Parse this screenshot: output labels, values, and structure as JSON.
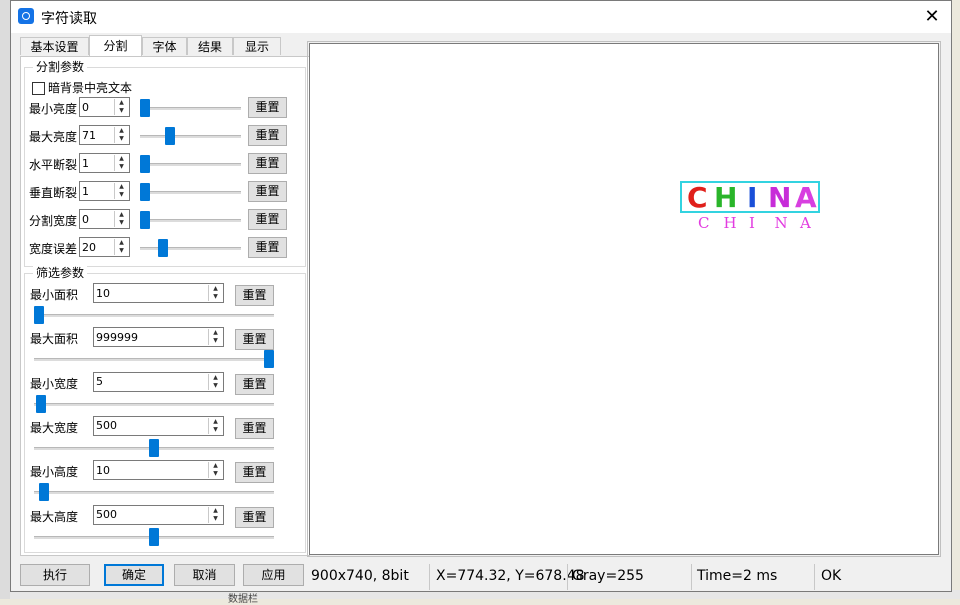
{
  "window": {
    "title": "字符读取",
    "close_glyph": "✕"
  },
  "tabs": [
    "基本设置",
    "分割",
    "字体",
    "结果",
    "显示"
  ],
  "active_tab": "分割",
  "segment": {
    "group_title": "分割参数",
    "checkbox_label": "暗背景中亮文本",
    "checkbox_checked": false,
    "rows": [
      {
        "label": "最小亮度",
        "value": "0",
        "reset": "重置",
        "slider": 0.0
      },
      {
        "label": "最大亮度",
        "value": "71",
        "reset": "重置",
        "slider": 0.28
      },
      {
        "label": "水平断裂",
        "value": "1",
        "reset": "重置",
        "slider": 0.0
      },
      {
        "label": "垂直断裂",
        "value": "1",
        "reset": "重置",
        "slider": 0.0
      },
      {
        "label": "分割宽度",
        "value": "0",
        "reset": "重置",
        "slider": 0.0
      },
      {
        "label": "宽度误差",
        "value": "20",
        "reset": "重置",
        "slider": 0.2
      }
    ]
  },
  "filter": {
    "group_title": "筛选参数",
    "rows": [
      {
        "label": "最小面积",
        "value": "10",
        "reset": "重置",
        "slider": 0.0
      },
      {
        "label": "最大面积",
        "value": "999999",
        "reset": "重置",
        "slider": 1.0
      },
      {
        "label": "最小宽度",
        "value": "5",
        "reset": "重置",
        "slider": 0.01
      },
      {
        "label": "最大宽度",
        "value": "500",
        "reset": "重置",
        "slider": 0.5
      },
      {
        "label": "最小高度",
        "value": "10",
        "reset": "重置",
        "slider": 0.02
      },
      {
        "label": "最大高度",
        "value": "500",
        "reset": "重置",
        "slider": 0.5
      }
    ]
  },
  "buttons": {
    "execute": "执行",
    "ok": "确定",
    "cancel": "取消",
    "apply": "应用"
  },
  "status": {
    "image_info": "900x740, 8bit",
    "coords": "X=774.32, Y=678.48",
    "gray": "Gray=255",
    "time": "Time=2 ms",
    "result": "OK"
  },
  "image": {
    "big_chars": [
      {
        "ch": "C",
        "color": "#e0201b"
      },
      {
        "ch": "H",
        "color": "#2ab52a"
      },
      {
        "ch": "I",
        "color": "#1a4fd8"
      },
      {
        "ch": "N",
        "color": "#c72cd8"
      },
      {
        "ch": "A",
        "color": "#d83fe0"
      }
    ],
    "small_chars": [
      "C",
      "H",
      "I",
      "N",
      "A"
    ]
  },
  "background": {
    "bottom_text": "数据栏"
  }
}
